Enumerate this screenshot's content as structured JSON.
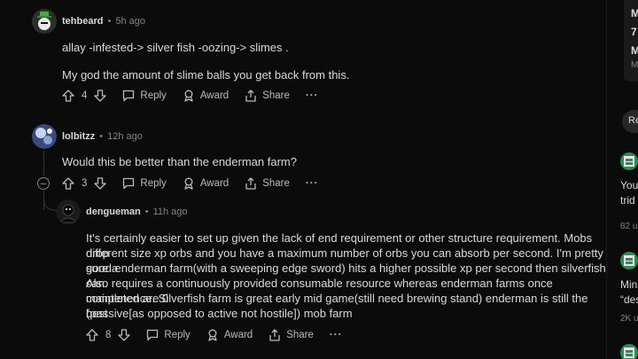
{
  "comments": [
    {
      "user": "tehbeard",
      "time": "5h ago",
      "lines": [
        "allay -infested-> silver fish -oozing-> slimes .",
        "My god the amount of slime balls you get back from this."
      ],
      "votes": "4"
    },
    {
      "user": "lolbitzz",
      "time": "12h ago",
      "lines": [
        "Would this be better than the enderman farm?"
      ],
      "votes": "3"
    },
    {
      "user": "dengueman",
      "time": "11h ago",
      "lines": [
        "It's certainly easier to set up given the lack of end requirement or other structure requirement. Mobs drop",
        "different size xp orbs and you have a maximum number of orbs you can absorb per second. I'm pretty sure a",
        "good enderman farm(with a sweeping edge sword) hits a higher possible xp per second then silverfish can.",
        "Also requires a continuously provided consumable resource whereas enderman farms once completed are 0",
        "maintenence. Silverfish farm is great early mid game(still need brewing stand) enderman is still the best",
        "(passive[as opposed to active not hostile]) mob farm"
      ],
      "votes": "8"
    }
  ],
  "actions": {
    "reply": "Reply",
    "award": "Award",
    "share": "Share",
    "more": "···"
  },
  "sidebar": {
    "t1": "M",
    "t2": "7",
    "t3": "M",
    "t4": "M",
    "pill": "Re",
    "p1_title_a": "You",
    "p1_title_b": "trid",
    "p1_meta": "82 u",
    "p2_title_a": "Min",
    "p2_title_b": "“des",
    "p2_meta": "2K u"
  },
  "colors": {
    "background": "#0b0b0c",
    "text": "#d7dadc",
    "muted": "#818384",
    "icon_green": "#2e8b57"
  }
}
